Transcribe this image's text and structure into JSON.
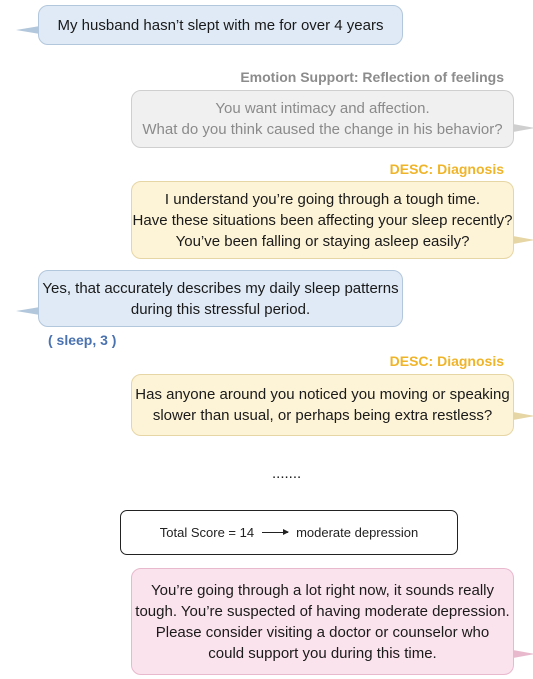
{
  "messages": {
    "user1": [
      "My husband hasn’t slept with me for over 4 years"
    ],
    "label_emotion": "Emotion Support: Reflection of feelings",
    "bot1": [
      "You want intimacy and affection.",
      "What do you think caused the change in his behavior?"
    ],
    "label_desc1": "DESC: Diagnosis",
    "bot2": [
      "I understand you’re going through a tough time.",
      "Have these situations been affecting your sleep recently?",
      "You’ve been falling or staying asleep easily?"
    ],
    "user2": [
      "Yes, that accurately describes my daily sleep patterns",
      "during this stressful period."
    ],
    "score_tag": "( sleep, 3 )",
    "label_desc2": "DESC: Diagnosis",
    "bot3": [
      "Has anyone around you noticed you moving or speaking",
      "slower than usual, or perhaps being extra restless?"
    ],
    "ellipsis": ".......",
    "total": {
      "left": "Total Score = 14",
      "right": "moderate depression"
    },
    "bot4": [
      "You’re going through a lot right now, it sounds really",
      "tough. You’re suspected of having moderate depression.",
      "Please consider visiting a doctor or counselor who",
      "could support you during this time."
    ]
  },
  "colors": {
    "user_bubble": "#dfeaf6",
    "gray_bubble": "#f0f0f0",
    "diagnosis_bubble": "#fdf3d6",
    "final_bubble": "#fbe3ee",
    "emotion_label": "#8c8c8c",
    "desc_label": "#f0b429",
    "score_tag": "#4a72b0"
  }
}
